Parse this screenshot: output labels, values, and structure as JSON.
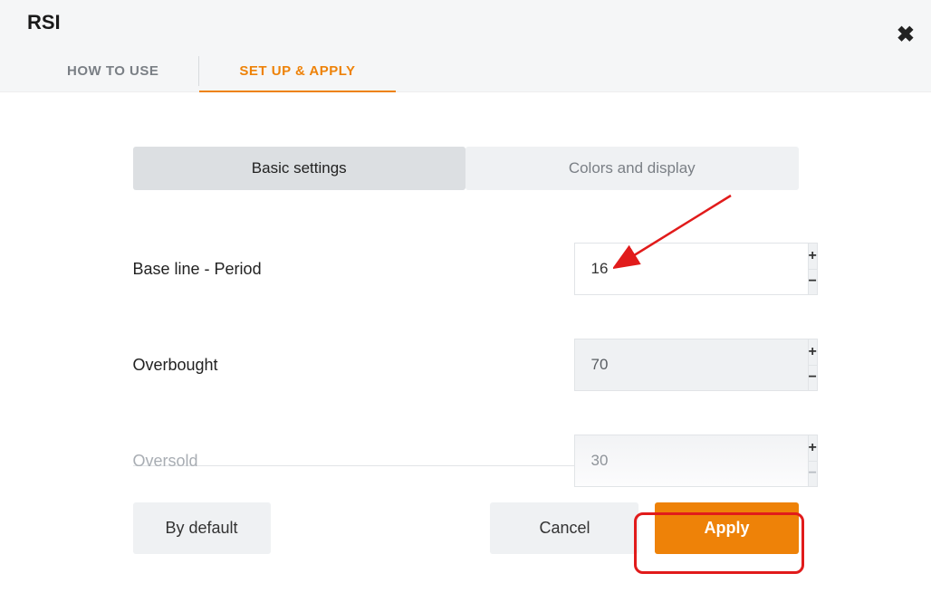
{
  "header": {
    "title": "RSI"
  },
  "tabs": {
    "howToUse": "HOW TO USE",
    "setup": "SET UP & APPLY"
  },
  "subtabs": {
    "basic": "Basic settings",
    "colors": "Colors and display"
  },
  "fields": {
    "baseLine": {
      "label": "Base line - Period",
      "value": "16"
    },
    "overbought": {
      "label": "Overbought",
      "value": "70"
    },
    "oversold": {
      "label": "Oversold",
      "value": "30"
    }
  },
  "buttons": {
    "byDefault": "By default",
    "cancel": "Cancel",
    "apply": "Apply"
  },
  "icons": {
    "plus": "+",
    "minus": "−"
  }
}
